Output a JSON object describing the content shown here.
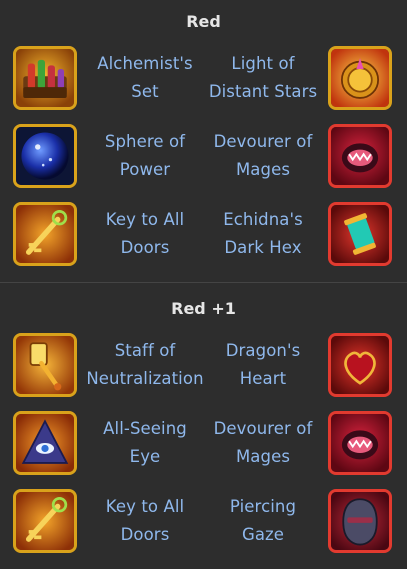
{
  "sections": [
    {
      "title": "Red",
      "rows": [
        {
          "left": {
            "name_line1": "Alchemist's",
            "name_line2": "Set",
            "icon": "alchemist-set-icon",
            "frame": "gold"
          },
          "right": {
            "name_line1": "Light of",
            "name_line2": "Distant Stars",
            "icon": "light-of-distant-stars-icon",
            "frame": "gold"
          }
        },
        {
          "left": {
            "name_line1": "Sphere of",
            "name_line2": "Power",
            "icon": "sphere-of-power-icon",
            "frame": "gold"
          },
          "right": {
            "name_line1": "Devourer of",
            "name_line2": "Mages",
            "icon": "devourer-of-mages-icon",
            "frame": "red"
          }
        },
        {
          "left": {
            "name_line1": "Key to All",
            "name_line2": "Doors",
            "icon": "key-to-all-doors-icon",
            "frame": "gold"
          },
          "right": {
            "name_line1": "Echidna's",
            "name_line2": "Dark Hex",
            "icon": "echidnas-dark-hex-icon",
            "frame": "red"
          }
        }
      ]
    },
    {
      "title": "Red +1",
      "rows": [
        {
          "left": {
            "name_line1": "Staff of",
            "name_line2": "Neutralization",
            "icon": "staff-of-neutralization-icon",
            "frame": "gold"
          },
          "right": {
            "name_line1": "Dragon's",
            "name_line2": "Heart",
            "icon": "dragons-heart-icon",
            "frame": "red"
          }
        },
        {
          "left": {
            "name_line1": "All-Seeing",
            "name_line2": "Eye",
            "icon": "all-seeing-eye-icon",
            "frame": "gold"
          },
          "right": {
            "name_line1": "Devourer of",
            "name_line2": "Mages",
            "icon": "devourer-of-mages-icon",
            "frame": "red"
          }
        },
        {
          "left": {
            "name_line1": "Key to All",
            "name_line2": "Doors",
            "icon": "key-to-all-doors-icon",
            "frame": "gold"
          },
          "right": {
            "name_line1": "Piercing",
            "name_line2": "Gaze",
            "icon": "piercing-gaze-icon",
            "frame": "red"
          }
        }
      ]
    }
  ],
  "colors": {
    "background": "#2d2d2d",
    "title_text": "#e6e6e6",
    "item_text": "#8fb8ec",
    "gold_frame": "#d9a21b",
    "red_frame": "#e23a2f"
  }
}
